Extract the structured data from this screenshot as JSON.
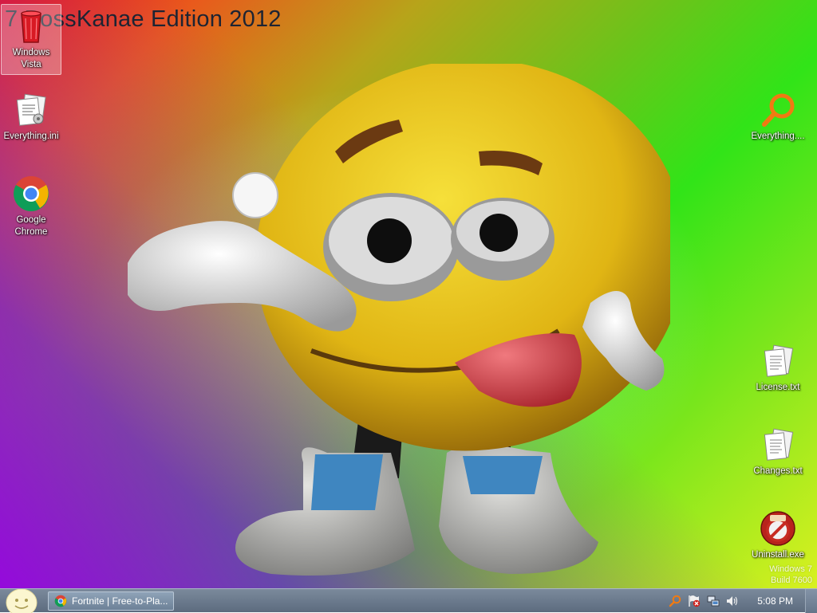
{
  "wallpaper": {
    "title": "7 BossKanae Edition 2012",
    "windows_build": [
      "Windows 7",
      "Build 7600"
    ]
  },
  "desktop_icons": {
    "left": [
      {
        "label": "Windows Vista",
        "icon": "recycle-bin-icon",
        "selected": true
      },
      {
        "label": "Everything.ini",
        "icon": "config-file-icon"
      },
      {
        "label": "Google Chrome",
        "icon": "chrome-icon"
      }
    ],
    "right": [
      {
        "label": "Everything....",
        "icon": "search-icon"
      },
      {
        "label": "License.txt",
        "icon": "text-file-icon"
      },
      {
        "label": "Changes.txt",
        "icon": "text-file-icon"
      },
      {
        "label": "Uninstall.exe",
        "icon": "nsis-installer-icon"
      }
    ]
  },
  "taskbar": {
    "start": {
      "icon": "smiley-start-orb-icon"
    },
    "tasks": [
      {
        "label": "Fortnite | Free-to-Pla...",
        "icon": "chrome-icon"
      }
    ],
    "tray": {
      "icons": [
        "search-icon",
        "action-center-flag-icon",
        "network-icon",
        "volume-icon"
      ],
      "clock": "5:08 PM"
    }
  },
  "colors": {
    "taskbar": "#6b7a8d",
    "icon_label": "#ffffff",
    "wallpaper_text": "#1d2433"
  }
}
